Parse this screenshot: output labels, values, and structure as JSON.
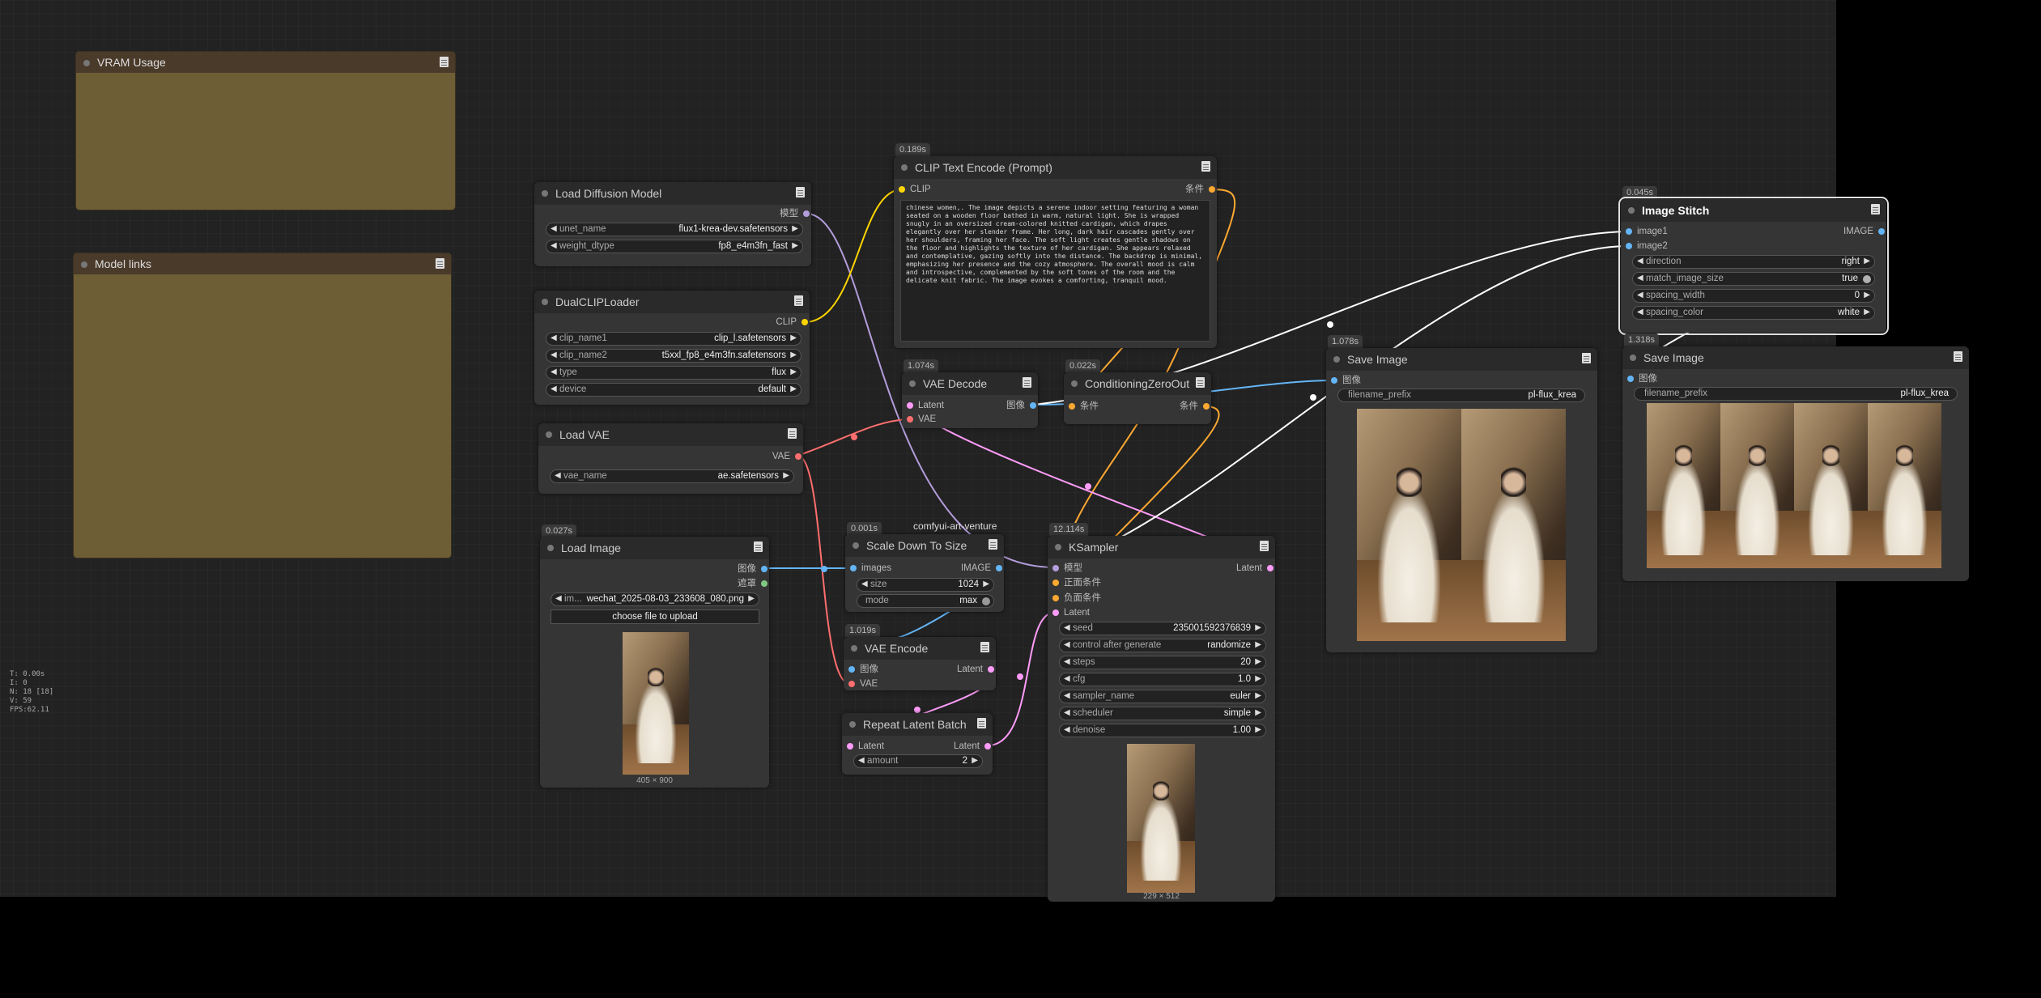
{
  "nodes": {
    "vram_usage": {
      "title": "VRAM Usage"
    },
    "model_links": {
      "title": "Model links"
    },
    "load_diffusion_model": {
      "title": "Load Diffusion Model",
      "outputs": [
        "模型"
      ],
      "widgets": [
        {
          "label": "unet_name",
          "value": "flux1-krea-dev.safetensors"
        },
        {
          "label": "weight_dtype",
          "value": "fp8_e4m3fn_fast"
        }
      ]
    },
    "dual_clip_loader": {
      "title": "DualCLIPLoader",
      "outputs": [
        "CLIP"
      ],
      "widgets": [
        {
          "label": "clip_name1",
          "value": "clip_l.safetensors"
        },
        {
          "label": "clip_name2",
          "value": "t5xxl_fp8_e4m3fn.safetensors"
        },
        {
          "label": "type",
          "value": "flux"
        },
        {
          "label": "device",
          "value": "default"
        }
      ]
    },
    "load_vae": {
      "title": "Load VAE",
      "outputs": [
        "VAE"
      ],
      "widgets": [
        {
          "label": "vae_name",
          "value": "ae.safetensors"
        }
      ]
    },
    "load_image": {
      "time": "0.027s",
      "title": "Load Image",
      "outputs": [
        "图像",
        "遮罩"
      ],
      "widgets": [
        {
          "label": "im...",
          "value": "wechat_2025-08-03_233608_080.png"
        }
      ],
      "button": "choose file to upload",
      "dims": "405 × 900"
    },
    "clip_text_encode": {
      "time": "0.189s",
      "title": "CLIP Text Encode (Prompt)",
      "inputs": [
        "CLIP"
      ],
      "outputs": [
        "条件"
      ],
      "text": "chinese women,. The image depicts a serene indoor setting featuring a woman seated on a wooden floor bathed in warm, natural light. She is wrapped snugly in an oversized cream-colored knitted cardigan, which drapes elegantly over her slender frame. Her long, dark hair cascades gently over her shoulders, framing her face. The soft light creates gentle shadows on the floor and highlights the texture of her cardigan. She appears relaxed and contemplative, gazing softly into the distance. The backdrop is minimal, emphasizing her presence and the cozy atmosphere. The overall mood is calm and introspective, complemented by the soft tones of the room and the delicate knit fabric. The image evokes a comforting, tranquil mood."
    },
    "vae_decode": {
      "time": "1.074s",
      "title": "VAE Decode",
      "inputs": [
        "Latent",
        "VAE"
      ],
      "outputs": [
        "图像"
      ]
    },
    "conditioning_zero_out": {
      "time": "0.022s",
      "title": "ConditioningZeroOut",
      "inputs": [
        "条件"
      ],
      "outputs": [
        "条件"
      ]
    },
    "scale_down_to_size": {
      "time": "0.001s",
      "group_label": "comfyui-art-venture",
      "title": "Scale Down To Size",
      "inputs": [
        "images"
      ],
      "outputs": [
        "IMAGE"
      ],
      "widgets": [
        {
          "label": "size",
          "value": "1024"
        },
        {
          "label": "mode",
          "value": "max"
        }
      ]
    },
    "vae_encode": {
      "time": "1.019s",
      "title": "VAE Encode",
      "inputs": [
        "图像",
        "VAE"
      ],
      "outputs": [
        "Latent"
      ]
    },
    "repeat_latent_batch": {
      "title": "Repeat Latent Batch",
      "inputs": [
        "Latent"
      ],
      "outputs": [
        "Latent"
      ],
      "widgets": [
        {
          "label": "amount",
          "value": "2"
        }
      ]
    },
    "ksampler": {
      "time": "12.114s",
      "title": "KSampler",
      "inputs": [
        "模型",
        "正面条件",
        "负面条件",
        "Latent"
      ],
      "outputs": [
        "Latent"
      ],
      "widgets": [
        {
          "label": "seed",
          "value": "235001592376839"
        },
        {
          "label": "control after generate",
          "value": "randomize"
        },
        {
          "label": "steps",
          "value": "20"
        },
        {
          "label": "cfg",
          "value": "1.0"
        },
        {
          "label": "sampler_name",
          "value": "euler"
        },
        {
          "label": "scheduler",
          "value": "simple"
        },
        {
          "label": "denoise",
          "value": "1.00"
        }
      ],
      "dims": "229 × 512"
    },
    "save_image_1": {
      "time": "1.078s",
      "title": "Save Image",
      "inputs": [
        "图像"
      ],
      "widgets": [
        {
          "label": "filename_prefix",
          "value": "pl-flux_krea"
        }
      ]
    },
    "image_stitch": {
      "time": "0.045s",
      "title": "Image Stitch",
      "inputs": [
        "image1",
        "image2"
      ],
      "outputs": [
        "IMAGE"
      ],
      "widgets": [
        {
          "label": "direction",
          "value": "right"
        },
        {
          "label": "match_image_size",
          "value": "true"
        },
        {
          "label": "spacing_width",
          "value": "0"
        },
        {
          "label": "spacing_color",
          "value": "white"
        }
      ]
    },
    "save_image_2": {
      "time": "1.318s",
      "title": "Save Image",
      "inputs": [
        "图像"
      ],
      "widgets": [
        {
          "label": "filename_prefix",
          "value": "pl-flux_krea"
        }
      ]
    }
  },
  "stats": [
    "T: 0.00s",
    "I: 0",
    "N: 18 [18]",
    "V: 59",
    "FPS:62.11"
  ],
  "colors": {
    "canvas": "#222222",
    "node": "#353535",
    "group": "#6e5e36",
    "wire_image": "#64b5f6",
    "wire_latent": "#ff9cf9",
    "wire_vae": "#ff6e6e",
    "wire_clip": "#ffd500",
    "wire_conditioning": "#ffa931",
    "wire_model": "#b39ddb",
    "wire_stitch": "#ffffff"
  }
}
